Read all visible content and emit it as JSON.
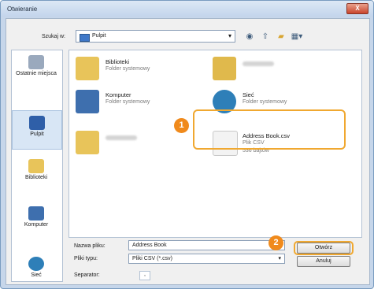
{
  "window": {
    "title": "Otwieranie",
    "close_label": "X"
  },
  "lookin": {
    "label": "Szukaj w:",
    "value": "Pulpit"
  },
  "places": [
    {
      "label": "Ostatnie miejsca"
    },
    {
      "label": "Pulpit"
    },
    {
      "label": "Biblioteki"
    },
    {
      "label": "Komputer"
    },
    {
      "label": "Sieć"
    }
  ],
  "files": [
    {
      "name": "Biblioteki",
      "type": "Folder systemowy"
    },
    {
      "name": "Komputer",
      "type": "Folder systemowy"
    },
    {
      "name": "Sieć",
      "type": "Folder systemowy"
    },
    {
      "name": "Address Book.csv",
      "type": "Plik CSV",
      "size": "536 bajtów"
    }
  ],
  "form": {
    "filename_label": "Nazwa pliku:",
    "filename_value": "Address Book",
    "filetype_label": "Pliki typu:",
    "filetype_value": "Pliki CSV (*.csv)",
    "separator_label": "Separator:",
    "open_button": "Otwórz",
    "cancel_button": "Anuluj"
  },
  "badges": {
    "one": "1",
    "two": "2"
  },
  "colors": {
    "accent": "#f08a1c",
    "selection": "#d8e6f5"
  }
}
